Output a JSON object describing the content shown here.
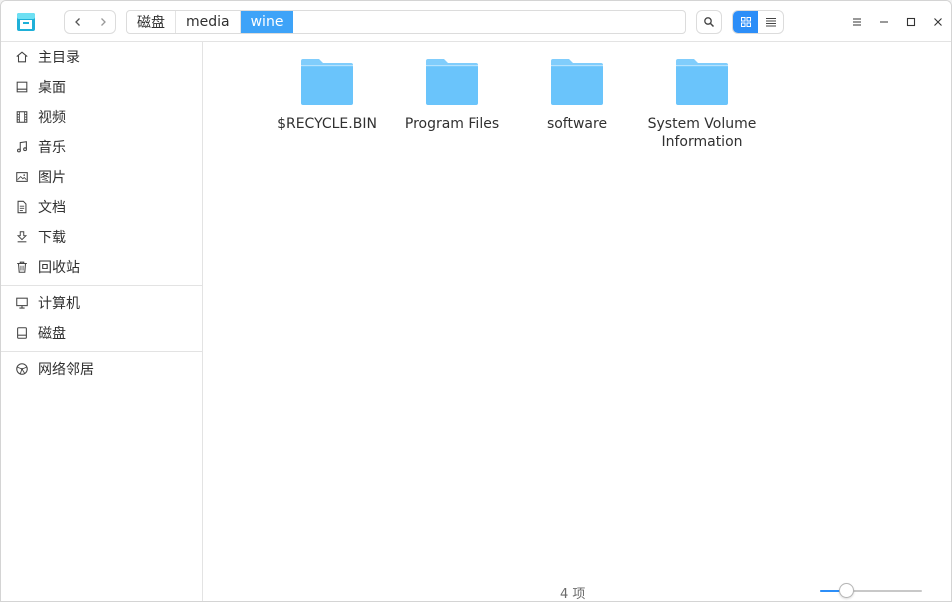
{
  "titlebar": {
    "breadcrumb": [
      "磁盘",
      "media",
      "wine"
    ],
    "active_crumb": 2
  },
  "sidebar": {
    "groups": [
      [
        {
          "label": "主目录",
          "icon": "home-icon"
        },
        {
          "label": "桌面",
          "icon": "desktop-icon"
        },
        {
          "label": "视频",
          "icon": "video-icon"
        },
        {
          "label": "音乐",
          "icon": "music-icon"
        },
        {
          "label": "图片",
          "icon": "picture-icon"
        },
        {
          "label": "文档",
          "icon": "document-icon"
        },
        {
          "label": "下载",
          "icon": "download-icon"
        },
        {
          "label": "回收站",
          "icon": "trash-icon"
        }
      ],
      [
        {
          "label": "计算机",
          "icon": "computer-icon"
        },
        {
          "label": "磁盘",
          "icon": "disk-icon"
        }
      ],
      [
        {
          "label": "网络邻居",
          "icon": "network-icon"
        }
      ]
    ]
  },
  "files": [
    {
      "name": "$RECYCLE.BIN"
    },
    {
      "name": "Program Files"
    },
    {
      "name": "software"
    },
    {
      "name": "System Volume\nInformation"
    }
  ],
  "status": {
    "item_count": "4 项"
  },
  "zoom": {
    "level": 0.25
  },
  "colors": {
    "accent": "#2c8ef8",
    "crumb_active": "#3ea3f8",
    "folder": "#6ac4fb"
  }
}
